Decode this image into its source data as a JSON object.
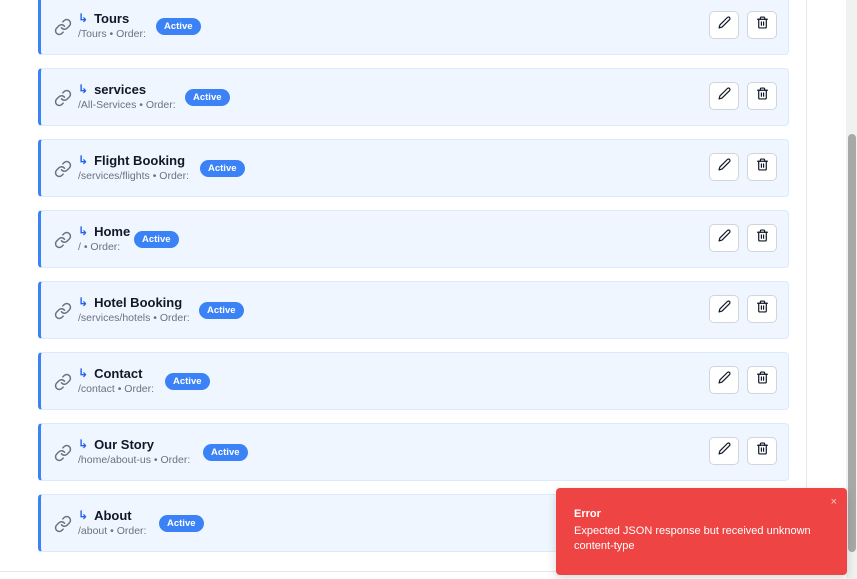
{
  "menu_items": [
    {
      "title": "Tours",
      "path": "/Tours",
      "order_label": "• Order:",
      "status": "Active"
    },
    {
      "title": "services",
      "path": "/All-Services",
      "order_label": "• Order:",
      "status": "Active"
    },
    {
      "title": "Flight Booking",
      "path": "/services/flights",
      "order_label": "• Order:",
      "status": "Active"
    },
    {
      "title": "Home",
      "path": "/",
      "order_label": "• Order:",
      "status": "Active"
    },
    {
      "title": "Hotel Booking",
      "path": "/services/hotels",
      "order_label": "• Order:",
      "status": "Active"
    },
    {
      "title": "Contact",
      "path": "/contact",
      "order_label": "• Order:",
      "status": "Active"
    },
    {
      "title": "Our Story",
      "path": "/home/about-us",
      "order_label": "• Order:",
      "status": "Active"
    },
    {
      "title": "About",
      "path": "/about",
      "order_label": "• Order:",
      "status": "Active"
    }
  ],
  "toast": {
    "title": "Error",
    "message": "Expected JSON response but received unknown content-type"
  },
  "colors": {
    "accent": "#3b82f6",
    "item_background": "#eff6ff",
    "toast_background": "#ef4444"
  },
  "icons": {
    "item_icon": "link-icon",
    "child_marker": "child-arrow-icon",
    "edit": "pencil-icon",
    "delete": "trash-icon"
  }
}
